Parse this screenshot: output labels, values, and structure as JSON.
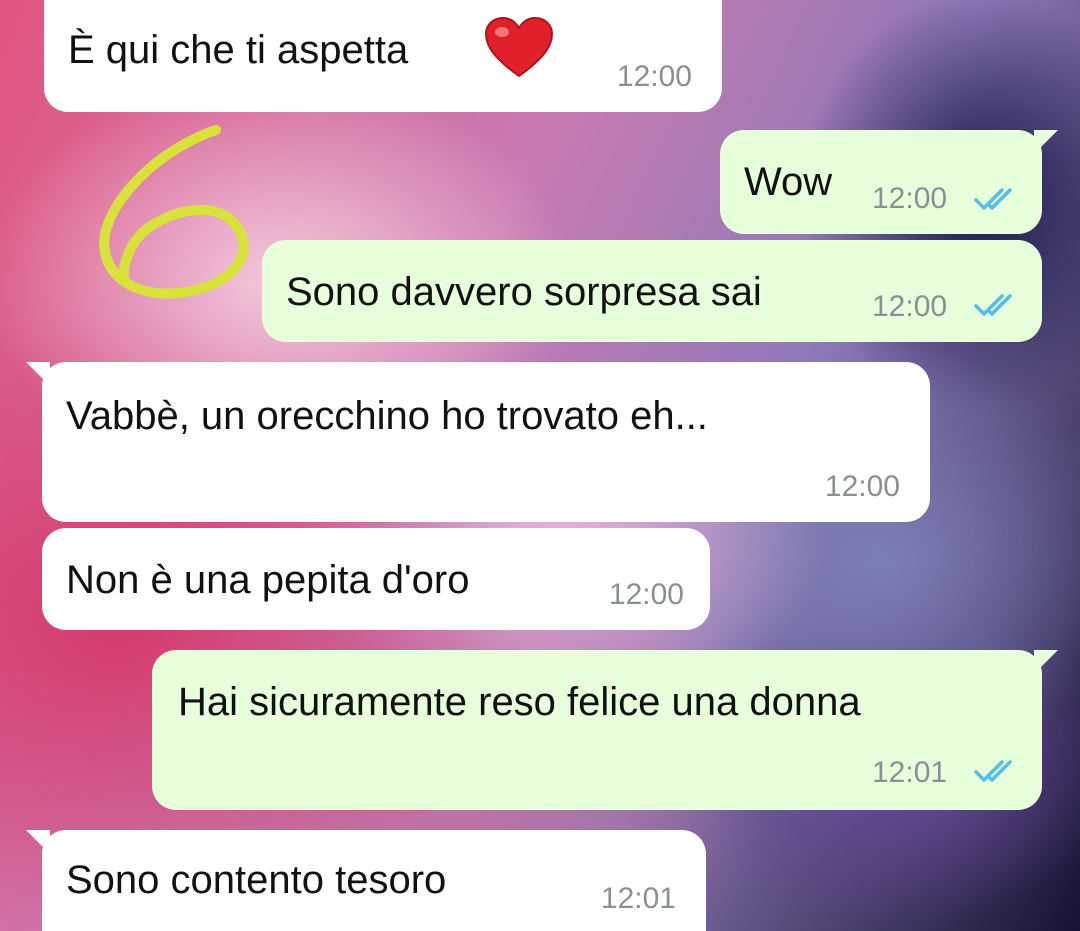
{
  "chat": {
    "messages": [
      {
        "text": "È qui che ti aspetta",
        "emoji": "red-heart",
        "time": "12:00",
        "direction": "in"
      },
      {
        "text": "Wow",
        "time": "12:00",
        "direction": "out",
        "status": "read"
      },
      {
        "text": "Sono davvero sorpresa sai",
        "time": "12:00",
        "direction": "out",
        "status": "read"
      },
      {
        "text": "Vabbè, un orecchino ho trovato eh...",
        "time": "12:00",
        "direction": "in"
      },
      {
        "text": "Non è una pepita d'oro",
        "time": "12:00",
        "direction": "in"
      },
      {
        "text": "Hai sicuramente reso felice una donna",
        "time": "12:01",
        "direction": "out",
        "status": "read"
      },
      {
        "text": "Sono contento tesoro",
        "time": "12:01",
        "direction": "in"
      }
    ]
  },
  "colors": {
    "incoming_bubble": "#ffffff",
    "outgoing_bubble": "#e7ffdb",
    "timestamp": "#8a8f94",
    "read_ticks": "#53bdeb",
    "annotation": "#d9e23a"
  },
  "icons": {
    "read_status": "double-check-icon",
    "emoji": "heart-emoji-icon"
  }
}
